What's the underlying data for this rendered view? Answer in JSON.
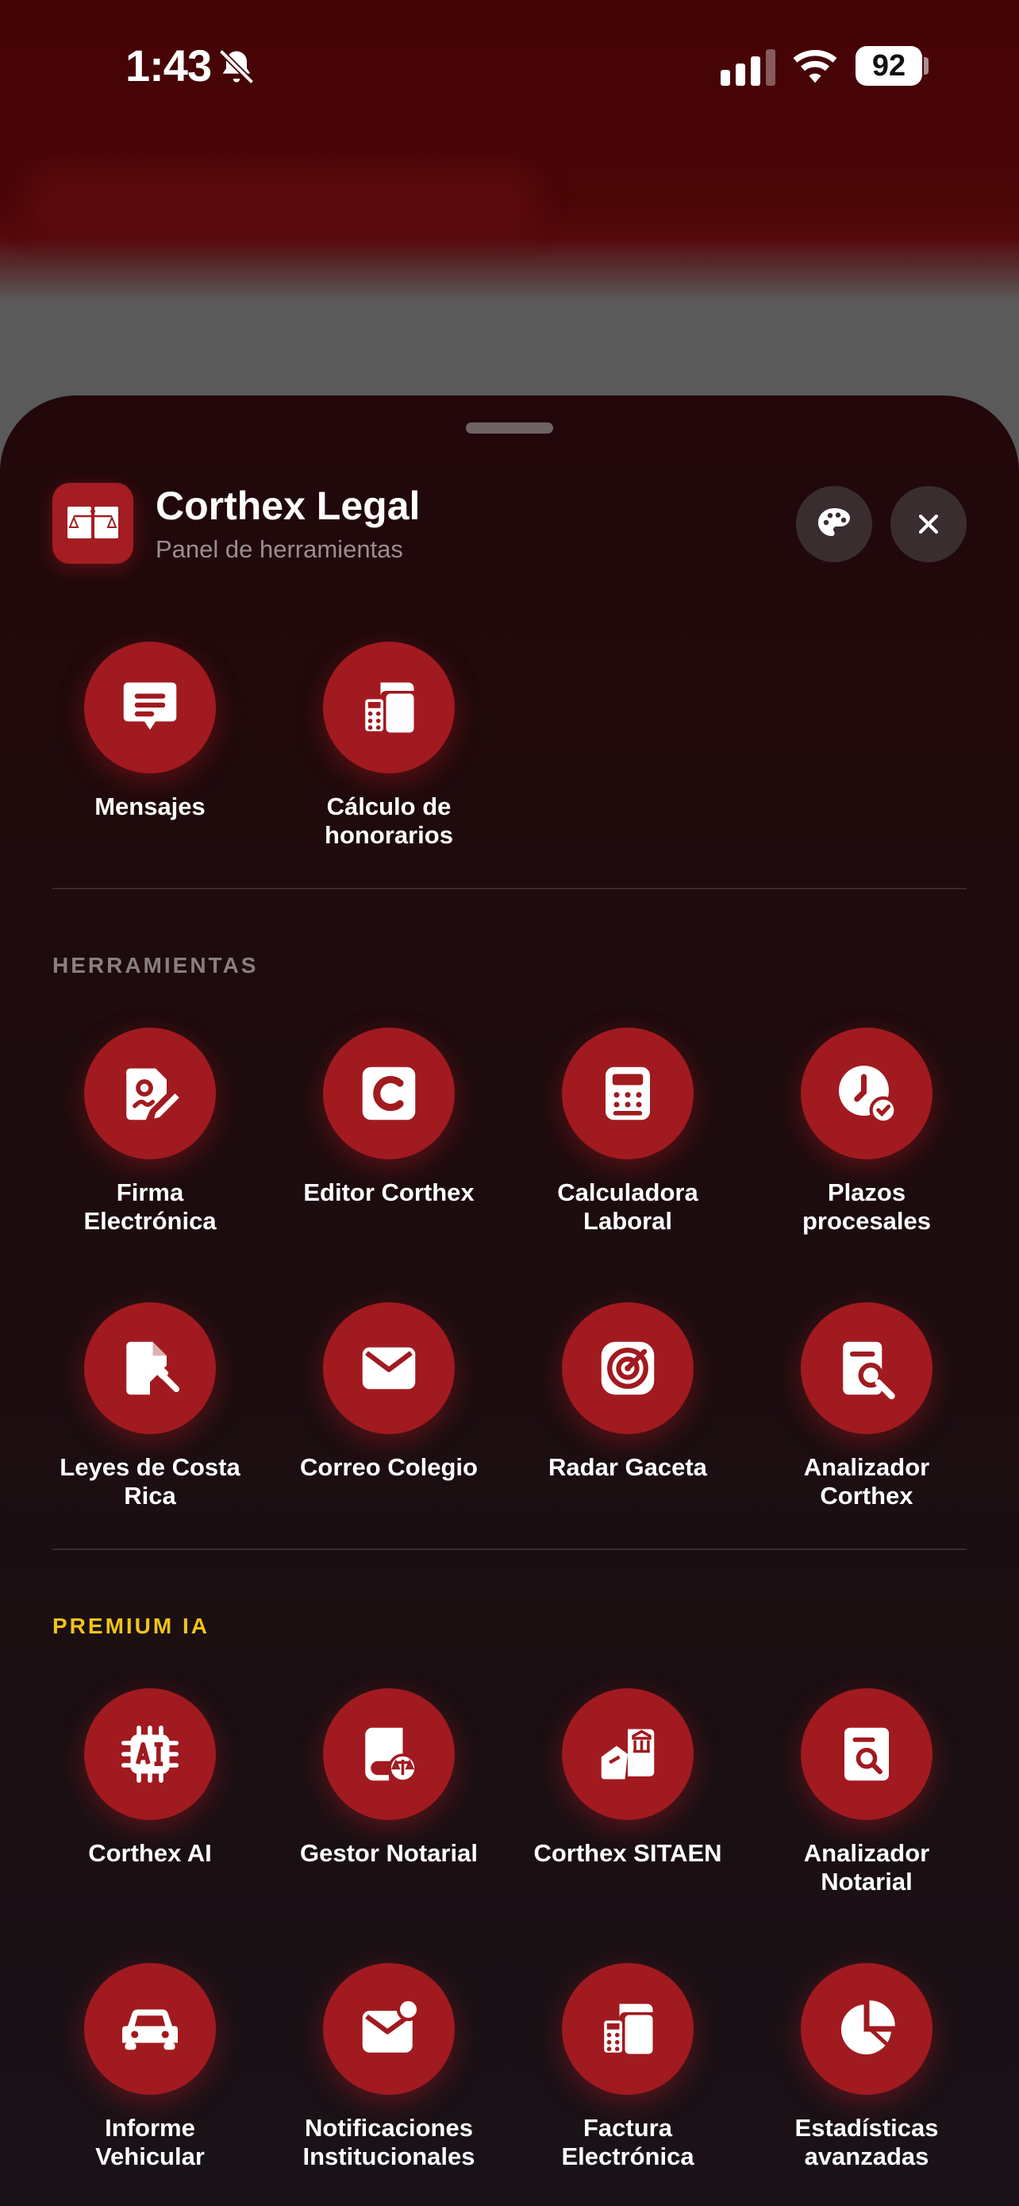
{
  "status_bar": {
    "time": "1:43",
    "battery": "92"
  },
  "header": {
    "title": "Corthex Legal",
    "subtitle": "Panel de herramientas"
  },
  "quick_actions": [
    {
      "label": "Mensajes",
      "icon": "message-icon"
    },
    {
      "label": "Cálculo de\nhonorarios",
      "icon": "fee-calculator-icon"
    }
  ],
  "sections": [
    {
      "title": "HERRAMIENTAS",
      "color": "#8a7f80",
      "items": [
        {
          "label": "Firma\nElectrónica",
          "icon": "signature-icon"
        },
        {
          "label": "Editor Corthex",
          "icon": "editor-c-icon"
        },
        {
          "label": "Calculadora\nLaboral",
          "icon": "calculator-icon"
        },
        {
          "label": "Plazos\nprocesales",
          "icon": "clock-check-icon"
        },
        {
          "label": "Leyes de Costa\nRica",
          "icon": "gavel-document-icon"
        },
        {
          "label": "Correo Colegio",
          "icon": "envelope-icon"
        },
        {
          "label": "Radar Gaceta",
          "icon": "radar-icon"
        },
        {
          "label": "Analizador\nCorthex",
          "icon": "document-search-icon"
        }
      ]
    },
    {
      "title": "PREMIUM IA",
      "color": "#f0c419",
      "items": [
        {
          "label": "Corthex AI",
          "icon": "ai-chip-icon"
        },
        {
          "label": "Gestor Notarial",
          "icon": "notary-book-icon"
        },
        {
          "label": "Corthex SITAEN",
          "icon": "land-registry-icon"
        },
        {
          "label": "Analizador\nNotarial",
          "icon": "notary-search-icon"
        },
        {
          "label": "Informe\nVehicular",
          "icon": "car-icon"
        },
        {
          "label": "Notificaciones\nInstitucionales",
          "icon": "envelope-badge-icon"
        },
        {
          "label": "Factura\nElectrónica",
          "icon": "invoice-icon"
        },
        {
          "label": "Estadísticas\navanzadas",
          "icon": "pie-chart-icon"
        }
      ]
    }
  ],
  "colors": {
    "accent": "#a11a1f",
    "sheet": "#1f0c0e",
    "premium": "#f0c419"
  }
}
